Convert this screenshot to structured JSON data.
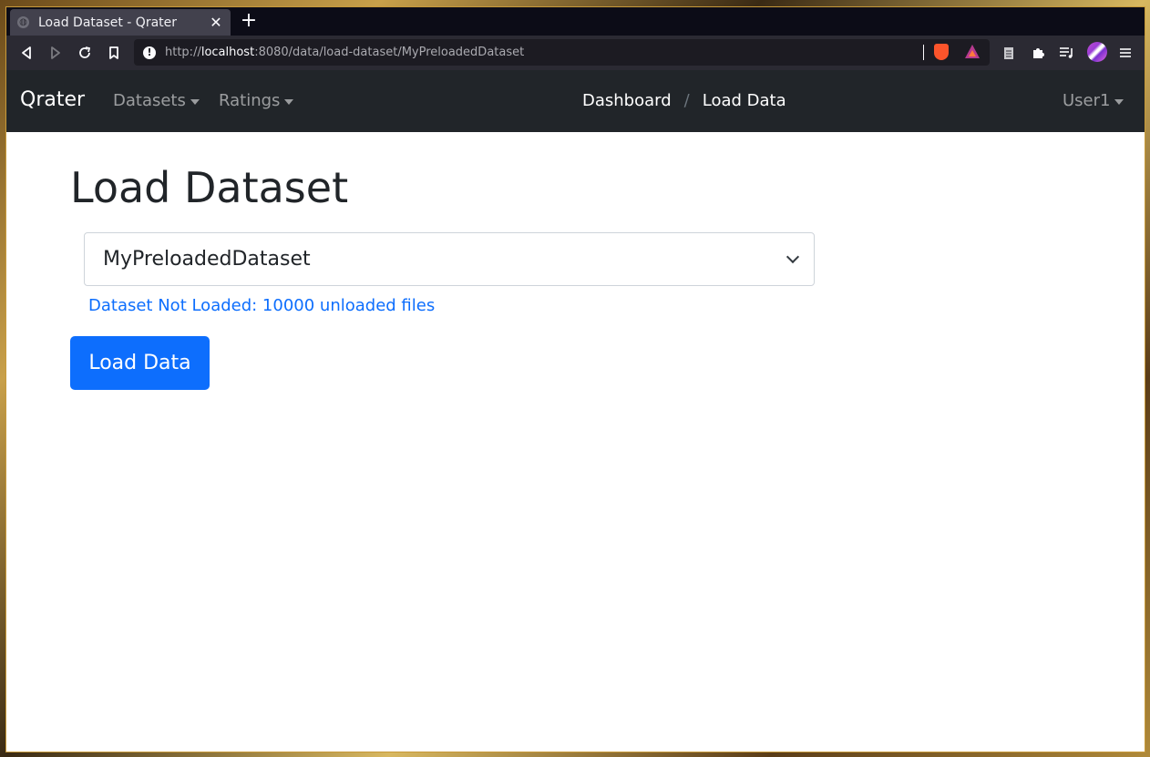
{
  "browser": {
    "tab_title": "Load Dataset - Qrater",
    "new_tab_symbol": "+",
    "url_scheme": "http://",
    "url_host": "localhost",
    "url_rest": ":8080/data/load-dataset/MyPreloadedDataset",
    "icons": [
      "back-icon",
      "forward-icon",
      "reload-icon",
      "bookmark-icon",
      "site-info-icon",
      "brave-shields-icon",
      "brave-rewards-icon",
      "reader-view-icon",
      "extensions-icon",
      "media-icon",
      "profile-icon",
      "menu-icon"
    ]
  },
  "app": {
    "brand": "Qrater",
    "nav": {
      "datasets": "Datasets",
      "ratings": "Ratings",
      "user": "User1"
    },
    "breadcrumb": {
      "dashboard": "Dashboard",
      "separator": "/",
      "current": "Load Data"
    }
  },
  "page": {
    "title": "Load Dataset",
    "dataset_select_value": "MyPreloadedDataset",
    "status": "Dataset Not Loaded: 10000 unloaded files",
    "load_button": "Load Data"
  },
  "colors": {
    "primary": "#0d6efd",
    "navbar": "#212529"
  }
}
